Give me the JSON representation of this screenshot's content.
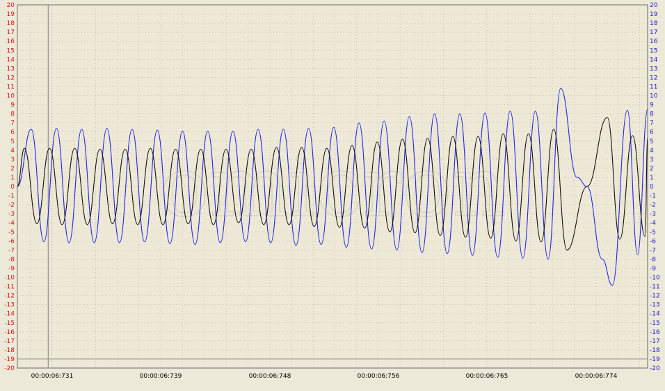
{
  "chart_data": {
    "type": "line",
    "title": "",
    "xlabel": "",
    "ylabel": "",
    "ylim": [
      -20,
      20
    ],
    "y_ticks": [
      20,
      19,
      18,
      17,
      16,
      15,
      14,
      13,
      12,
      11,
      10,
      9,
      8,
      7,
      6,
      5,
      4,
      3,
      2,
      1,
      0,
      -1,
      -2,
      -3,
      -4,
      -5,
      -6,
      -7,
      -8,
      -9,
      -10,
      -11,
      -12,
      -13,
      -14,
      -15,
      -16,
      -17,
      -18,
      -19,
      -20
    ],
    "x_tick_labels": [
      "00:00:06:731",
      "00:00:06:739",
      "00:00:06:748",
      "00:00:06:756",
      "00:00:06:765",
      "00:00:06:774"
    ],
    "grid": true,
    "cursor_lines": {
      "vertical_x_fraction": 0.049,
      "horizontal_y": -19
    },
    "watermark": "omicron",
    "series": [
      {
        "color": "#2222ee",
        "points": [
          [
            0.0,
            0.0
          ],
          [
            0.022,
            6.3
          ],
          [
            0.042,
            -6.1
          ],
          [
            0.062,
            6.4
          ],
          [
            0.082,
            -6.2
          ],
          [
            0.102,
            6.3
          ],
          [
            0.122,
            -6.2
          ],
          [
            0.142,
            6.4
          ],
          [
            0.162,
            -6.2
          ],
          [
            0.182,
            6.3
          ],
          [
            0.202,
            -6.1
          ],
          [
            0.222,
            6.2
          ],
          [
            0.242,
            -6.3
          ],
          [
            0.262,
            6.1
          ],
          [
            0.282,
            -6.4
          ],
          [
            0.302,
            6.1
          ],
          [
            0.322,
            -6.2
          ],
          [
            0.342,
            6.1
          ],
          [
            0.362,
            -6.1
          ],
          [
            0.382,
            6.3
          ],
          [
            0.402,
            -6.2
          ],
          [
            0.422,
            6.3
          ],
          [
            0.442,
            -6.5
          ],
          [
            0.462,
            6.4
          ],
          [
            0.482,
            -6.4
          ],
          [
            0.502,
            6.5
          ],
          [
            0.522,
            -6.7
          ],
          [
            0.542,
            7.0
          ],
          [
            0.562,
            -6.9
          ],
          [
            0.582,
            7.2
          ],
          [
            0.602,
            -7.0
          ],
          [
            0.622,
            7.7
          ],
          [
            0.642,
            -7.3
          ],
          [
            0.662,
            8.0
          ],
          [
            0.682,
            -7.4
          ],
          [
            0.702,
            8.0
          ],
          [
            0.722,
            -7.6
          ],
          [
            0.742,
            8.1
          ],
          [
            0.762,
            -7.8
          ],
          [
            0.782,
            8.3
          ],
          [
            0.802,
            -7.9
          ],
          [
            0.822,
            8.3
          ],
          [
            0.842,
            -8.0
          ],
          [
            0.862,
            10.8
          ],
          [
            0.888,
            1.0
          ],
          [
            0.904,
            0.0
          ],
          [
            0.928,
            -8.0
          ],
          [
            0.944,
            -10.9
          ],
          [
            0.968,
            8.4
          ],
          [
            0.984,
            -7.5
          ],
          [
            1.0,
            8.5
          ]
        ]
      },
      {
        "color": "#111111",
        "points": [
          [
            0.0,
            0.0
          ],
          [
            0.011,
            4.2
          ],
          [
            0.031,
            -4.1
          ],
          [
            0.051,
            4.2
          ],
          [
            0.071,
            -4.2
          ],
          [
            0.091,
            4.2
          ],
          [
            0.111,
            -4.2
          ],
          [
            0.131,
            4.1
          ],
          [
            0.151,
            -4.1
          ],
          [
            0.171,
            4.1
          ],
          [
            0.191,
            -4.2
          ],
          [
            0.211,
            4.2
          ],
          [
            0.231,
            -4.2
          ],
          [
            0.251,
            4.1
          ],
          [
            0.271,
            -4.1
          ],
          [
            0.291,
            4.1
          ],
          [
            0.311,
            -4.2
          ],
          [
            0.331,
            4.1
          ],
          [
            0.351,
            -4.0
          ],
          [
            0.371,
            4.1
          ],
          [
            0.391,
            -4.2
          ],
          [
            0.411,
            4.3
          ],
          [
            0.431,
            -4.2
          ],
          [
            0.451,
            4.3
          ],
          [
            0.471,
            -4.4
          ],
          [
            0.491,
            4.2
          ],
          [
            0.511,
            -4.5
          ],
          [
            0.531,
            4.5
          ],
          [
            0.551,
            -4.6
          ],
          [
            0.571,
            4.9
          ],
          [
            0.591,
            -5.0
          ],
          [
            0.611,
            5.2
          ],
          [
            0.631,
            -5.1
          ],
          [
            0.651,
            5.3
          ],
          [
            0.671,
            -5.4
          ],
          [
            0.691,
            5.5
          ],
          [
            0.711,
            -5.6
          ],
          [
            0.731,
            5.5
          ],
          [
            0.751,
            -5.7
          ],
          [
            0.771,
            5.8
          ],
          [
            0.791,
            -6.0
          ],
          [
            0.811,
            5.8
          ],
          [
            0.831,
            -6.1
          ],
          [
            0.851,
            6.3
          ],
          [
            0.872,
            -7.0
          ],
          [
            0.904,
            0.0
          ],
          [
            0.936,
            7.6
          ],
          [
            0.956,
            -5.8
          ],
          [
            0.976,
            5.6
          ],
          [
            0.996,
            -5.5
          ],
          [
            1.0,
            5.4
          ]
        ]
      }
    ]
  }
}
